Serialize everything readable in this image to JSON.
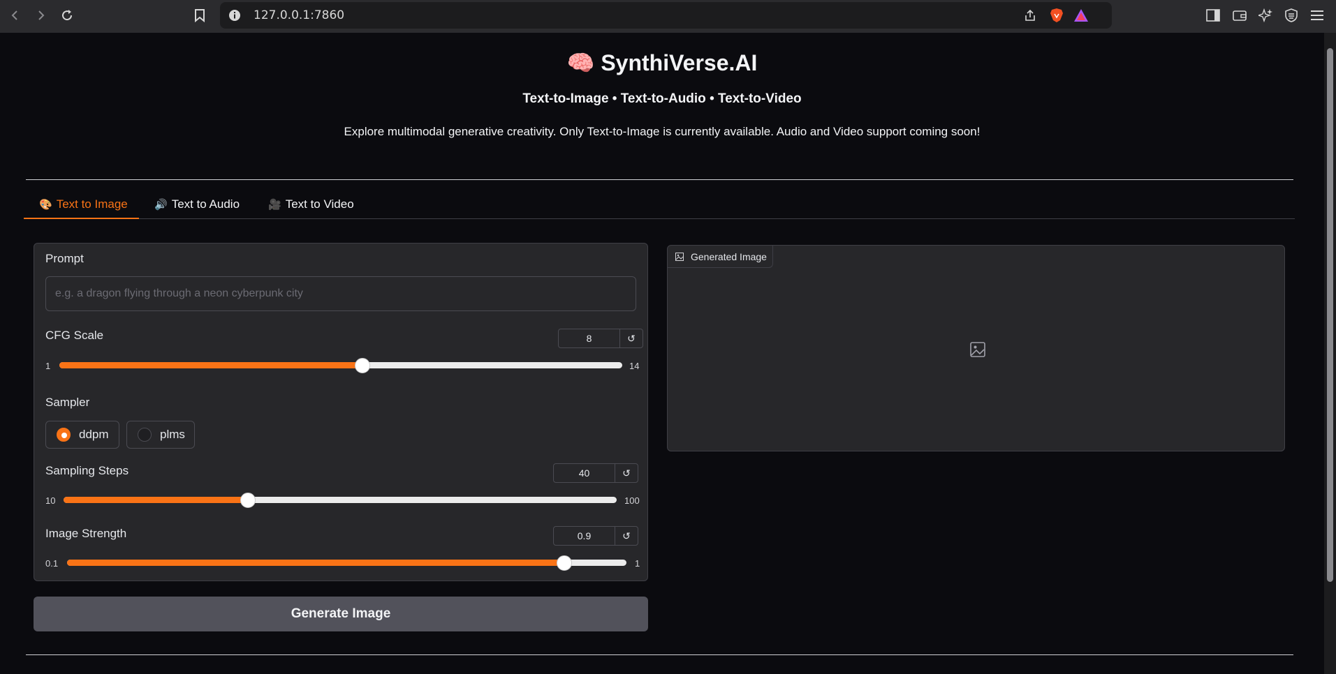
{
  "browser": {
    "url": "127.0.0.1:7860"
  },
  "header": {
    "title": "🧠 SynthiVerse.AI",
    "subtitle": "Text-to-Image • Text-to-Audio • Text-to-Video",
    "description": "Explore multimodal generative creativity. Only Text-to-Image is currently available. Audio and Video support coming soon!"
  },
  "tabs": [
    {
      "icon": "🎨",
      "label": "Text to Image",
      "active": true
    },
    {
      "icon": "🔊",
      "label": "Text to Audio",
      "active": false
    },
    {
      "icon": "🎥",
      "label": "Text to Video",
      "active": false
    }
  ],
  "form": {
    "prompt": {
      "label": "Prompt",
      "placeholder": "e.g. a dragon flying through a neon cyberpunk city",
      "value": ""
    },
    "cfg_scale": {
      "label": "CFG Scale",
      "value": "8",
      "min": "1",
      "max": "14",
      "fraction": 0.538
    },
    "sampler": {
      "label": "Sampler",
      "options": [
        "ddpm",
        "plms"
      ],
      "selected": "ddpm"
    },
    "sampling_steps": {
      "label": "Sampling Steps",
      "value": "40",
      "min": "10",
      "max": "100",
      "fraction": 0.333
    },
    "image_strength": {
      "label": "Image Strength",
      "value": "0.9",
      "min": "0.1",
      "max": "1",
      "fraction": 0.889
    },
    "reset_glyph": "↺",
    "generate_label": "Generate Image"
  },
  "output": {
    "label": "Generated Image"
  },
  "colors": {
    "accent": "#f97316",
    "background": "#0b0b0f",
    "panel": "#27272a",
    "button": "#52525b"
  }
}
